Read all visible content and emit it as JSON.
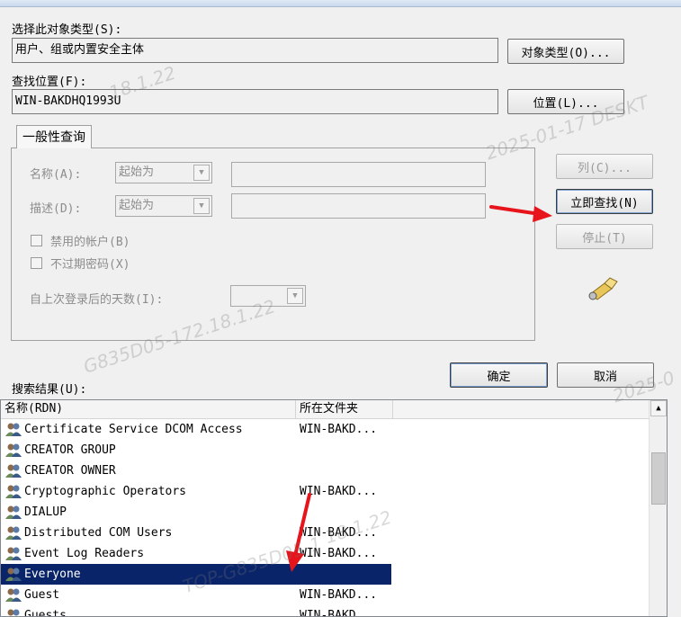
{
  "object_type": {
    "label": "选择此对象类型(S):",
    "value": "用户、组或内置安全主体",
    "button": "对象类型(O)..."
  },
  "location": {
    "label": "查找位置(F):",
    "value": "WIN-BAKDHQ1993U",
    "button": "位置(L)..."
  },
  "query": {
    "tab": "一般性查询",
    "name_label": "名称(A):",
    "name_combo": "起始为",
    "desc_label": "描述(D):",
    "desc_combo": "起始为",
    "disabled_accounts": "禁用的帐户(B)",
    "non_expiring": "不过期密码(X)",
    "days_label": "自上次登录后的天数(I):"
  },
  "side_buttons": {
    "columns": "列(C)...",
    "find_now": "立即查找(N)",
    "stop": "停止(T)"
  },
  "dialog_buttons": {
    "ok": "确定",
    "cancel": "取消"
  },
  "results": {
    "label": "搜索结果(U):",
    "col_name": "名称(RDN)",
    "col_folder": "所在文件夹",
    "rows": [
      {
        "name": "Certificate Service DCOM Access",
        "folder": "WIN-BAKD..."
      },
      {
        "name": "CREATOR GROUP",
        "folder": ""
      },
      {
        "name": "CREATOR OWNER",
        "folder": ""
      },
      {
        "name": "Cryptographic Operators",
        "folder": "WIN-BAKD..."
      },
      {
        "name": "DIALUP",
        "folder": ""
      },
      {
        "name": "Distributed COM Users",
        "folder": "WIN-BAKD..."
      },
      {
        "name": "Event Log Readers",
        "folder": "WIN-BAKD..."
      },
      {
        "name": "Everyone",
        "folder": ""
      },
      {
        "name": "Guest",
        "folder": "WIN-BAKD..."
      },
      {
        "name": "Guests",
        "folder": "WIN-BAKD..."
      }
    ],
    "selected_index": 7
  },
  "watermarks": [
    "2025-01-17 DESKTOP-G835D05-172.18.1.22",
    "G835D05-172.18.1.22",
    "2025-01-17 DESKT",
    "2025-0",
    "TOP-G835D05-1",
    "G835D05-172.18.1.22",
    "18.1.22"
  ],
  "colors": {
    "selection": "#0a246a",
    "arrow": "#e8141c"
  }
}
